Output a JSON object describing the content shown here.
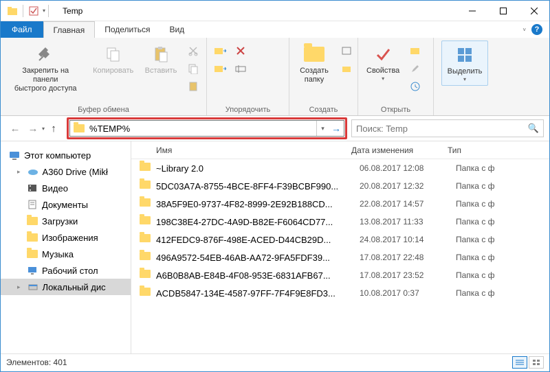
{
  "window": {
    "title": "Temp"
  },
  "tabs": {
    "file": "Файл",
    "home": "Главная",
    "share": "Поделиться",
    "view": "Вид"
  },
  "ribbon": {
    "clipboard": {
      "label": "Буфер обмена",
      "pin": "Закрепить на панели\nбыстрого доступа",
      "copy": "Копировать",
      "paste": "Вставить"
    },
    "organize": {
      "label": "Упорядочить"
    },
    "new": {
      "label": "Создать",
      "new_folder": "Создать\nпапку"
    },
    "open": {
      "label": "Открыть",
      "properties": "Свойства"
    },
    "select": {
      "label": "",
      "select_btn": "Выделить"
    }
  },
  "address": {
    "value": "%TEMP%"
  },
  "search": {
    "placeholder": "Поиск: Temp"
  },
  "sidebar": {
    "root": "Этот компьютер",
    "items": [
      {
        "icon": "cloud",
        "label": "A360 Drive (Mikł"
      },
      {
        "icon": "video",
        "label": "Видео"
      },
      {
        "icon": "doc",
        "label": "Документы"
      },
      {
        "icon": "download",
        "label": "Загрузки"
      },
      {
        "icon": "image",
        "label": "Изображения"
      },
      {
        "icon": "music",
        "label": "Музыка"
      },
      {
        "icon": "desktop",
        "label": "Рабочий стол"
      },
      {
        "icon": "disk",
        "label": "Локальный дис"
      }
    ]
  },
  "columns": {
    "name": "Имя",
    "date": "Дата изменения",
    "type": "Тип"
  },
  "rows": [
    {
      "name": "~Library 2.0",
      "date": "06.08.2017 12:08",
      "type": "Папка с ф"
    },
    {
      "name": "5DC03A7A-8755-4BCE-8FF4-F39BCBF990...",
      "date": "20.08.2017 12:32",
      "type": "Папка с ф"
    },
    {
      "name": "38A5F9E0-9737-4F82-8999-2E92B188CD...",
      "date": "22.08.2017 14:57",
      "type": "Папка с ф"
    },
    {
      "name": "198C38E4-27DC-4A9D-B82E-F6064CD77...",
      "date": "13.08.2017 11:33",
      "type": "Папка с ф"
    },
    {
      "name": "412FEDC9-876F-498E-ACED-D44CB29D...",
      "date": "24.08.2017 10:14",
      "type": "Папка с ф"
    },
    {
      "name": "496A9572-54EB-46AB-AA72-9FA5FDF39...",
      "date": "17.08.2017 22:48",
      "type": "Папка с ф"
    },
    {
      "name": "A6B0B8AB-E84B-4F08-953E-6831AFB67...",
      "date": "17.08.2017 23:52",
      "type": "Папка с ф"
    },
    {
      "name": "ACDB5847-134E-4587-97FF-7F4F9E8FD3...",
      "date": "10.08.2017 0:37",
      "type": "Папка с ф"
    }
  ],
  "status": {
    "count_label": "Элементов: 401"
  }
}
